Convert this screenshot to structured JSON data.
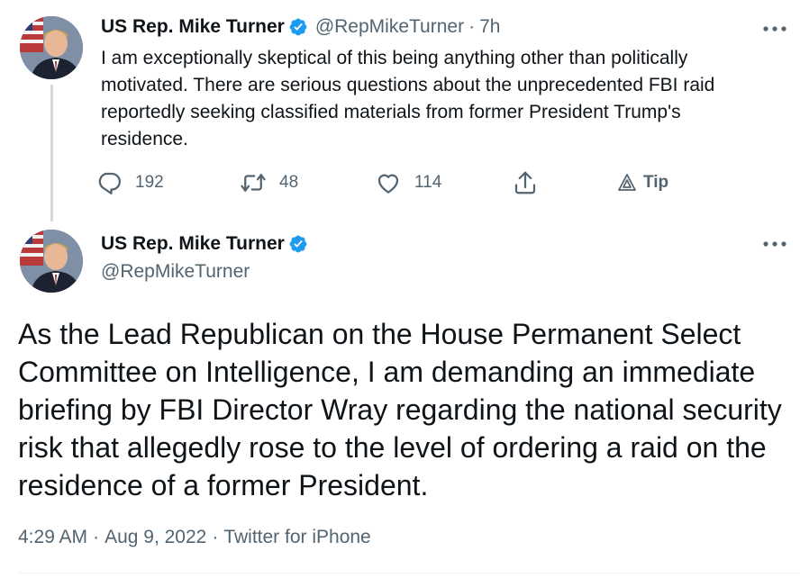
{
  "colors": {
    "verified_badge": "#1d9bf0",
    "secondary_text": "#536471",
    "primary_text": "#0f1419",
    "thread_line": "#cfd9de"
  },
  "reply_tweet": {
    "author_name": "US Rep. Mike Turner",
    "handle": "@RepMikeTurner",
    "separator": "·",
    "time_ago": "7h",
    "text": "I am exceptionally skeptical of this being anything other than politically motivated. There are serious questions about the unprecedented FBI raid reportedly seeking classified materials from former President Trump's residence.",
    "actions": {
      "reply_count": "192",
      "retweet_count": "48",
      "like_count": "114",
      "tip_label": "Tip"
    },
    "icons": [
      "verified-icon",
      "more-icon",
      "reply-icon",
      "retweet-icon",
      "like-icon",
      "share-icon",
      "tip-icon"
    ]
  },
  "main_tweet": {
    "author_name": "US Rep. Mike Turner",
    "handle": "@RepMikeTurner",
    "text": "As the Lead Republican on the House Permanent Select Committee on Intelligence, I am demanding an immediate briefing by FBI Director Wray regarding the national security risk that allegedly rose to the level of ordering a raid on the residence of a former President.",
    "time": "4:29 AM",
    "date": "Aug 9, 2022",
    "source": "Twitter for iPhone",
    "meta_separator": "·"
  }
}
